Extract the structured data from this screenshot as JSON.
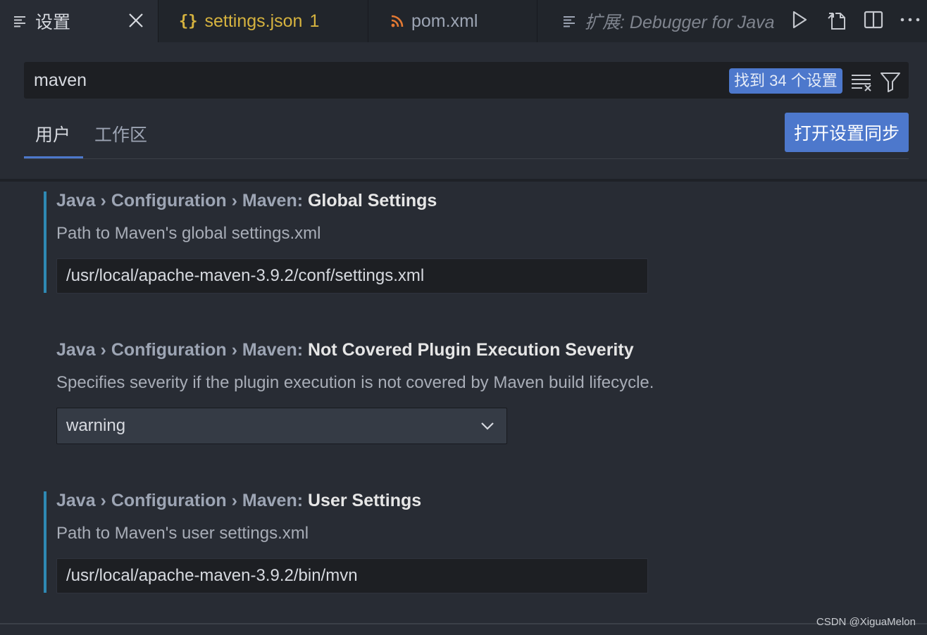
{
  "tabs": [
    {
      "label": "设置",
      "icon": "settings-list-icon",
      "active": true
    },
    {
      "label": "settings.json",
      "badge": "1",
      "icon": "json-braces-icon"
    },
    {
      "label": "pom.xml",
      "icon": "rss-xml-icon"
    },
    {
      "label": "扩展: Debugger for Java",
      "icon": "extension-doc-icon"
    }
  ],
  "search": {
    "query": "maven",
    "result_count": "找到 34 个设置"
  },
  "scopes": {
    "user": "用户",
    "workspace": "工作区",
    "sync_button": "打开设置同步"
  },
  "settings": [
    {
      "prefix": "Java › Configuration › Maven: ",
      "name": "Global Settings",
      "description": "Path to Maven's global settings.xml",
      "value": "/usr/local/apache-maven-3.9.2/conf/settings.xml",
      "control": "text",
      "modified": true
    },
    {
      "prefix": "Java › Configuration › Maven: ",
      "name": "Not Covered Plugin Execution Severity",
      "description": "Specifies severity if the plugin execution is not covered by Maven build lifecycle.",
      "value": "warning",
      "control": "select",
      "modified": false
    },
    {
      "prefix": "Java › Configuration › Maven: ",
      "name": "User Settings",
      "description": "Path to Maven's user settings.xml",
      "value": "/usr/local/apache-maven-3.9.2/bin/mvn",
      "control": "text",
      "modified": true
    }
  ],
  "watermark": "CSDN @XiguaMelon",
  "colors": {
    "accent": "#4d78cc",
    "modified_bar": "#2f89b3",
    "background": "#282c34",
    "json_yellow": "#d6b33f",
    "xml_orange": "#e37933"
  }
}
